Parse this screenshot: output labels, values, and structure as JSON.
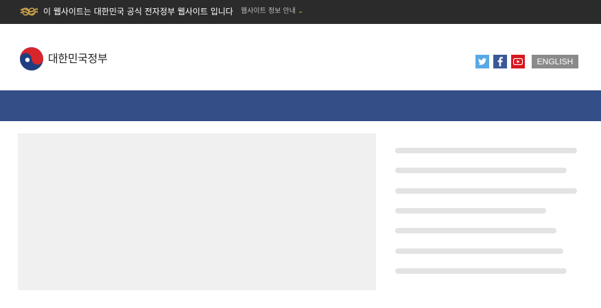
{
  "top_bar": {
    "notice": "이 웹사이트는 대한민국 공식 전자정부 웹사이트 입니다",
    "site_info_link": "웹사이트 정보 안내",
    "emblem_icon": "eg-emblem-icon"
  },
  "header": {
    "logo_text": "대한민국정부",
    "logo_icon": "taegeuk-logo-icon",
    "social": [
      {
        "name": "twitter",
        "icon": "twitter-icon",
        "color": "#5aa9e6"
      },
      {
        "name": "facebook",
        "icon": "facebook-icon",
        "color": "#3b5998"
      },
      {
        "name": "youtube",
        "icon": "youtube-icon",
        "color": "#d6181f"
      }
    ],
    "english_button": "ENGLISH"
  },
  "colors": {
    "top_bar_bg": "#2b2b2b",
    "nav_bar_bg": "#344e87",
    "placeholder_bg": "#f0f0f0",
    "skeleton_line": "#e3e3e3",
    "english_button_bg": "#8a8a8a"
  }
}
